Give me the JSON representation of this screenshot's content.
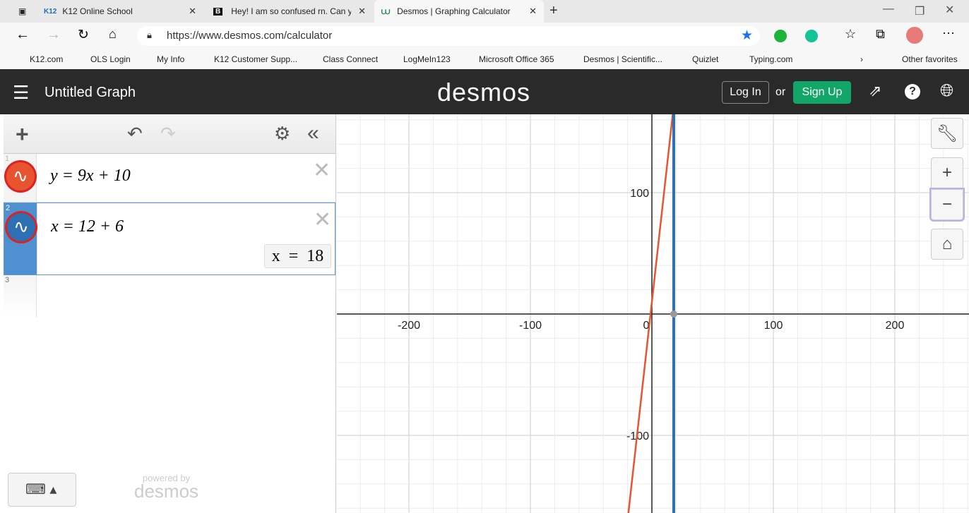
{
  "browser": {
    "tabs": [
      {
        "label": "K12 Online School",
        "icon": "k12-icon"
      },
      {
        "label": "Hey! I am so confused rn. Can yo",
        "icon": "brainly-icon"
      },
      {
        "label": "Desmos | Graphing Calculator",
        "icon": "desmos-icon"
      }
    ],
    "url": "https://www.desmos.com/calculator",
    "bookmarks": [
      "K12.com",
      "OLS Login",
      "My Info",
      "K12 Customer Supp...",
      "Class Connect",
      "LogMeIn123",
      "Microsoft Office 365",
      "Desmos | Scientific...",
      "Quizlet",
      "Typing.com"
    ],
    "other_favorites": "Other favorites"
  },
  "header": {
    "title": "Untitled Graph",
    "logo": "desmos",
    "login": "Log In",
    "or": "or",
    "signup": "Sign Up"
  },
  "expressions": [
    {
      "num": "1",
      "latex": "y = 9x + 10",
      "color": "#e8542f"
    },
    {
      "num": "2",
      "latex": "x = 12 + 6",
      "color": "#2d70b3",
      "result": "x  =  18"
    },
    {
      "num": "3",
      "latex": ""
    }
  ],
  "footer": {
    "powered_by": "powered by",
    "brand": "desmos"
  },
  "graph": {
    "x_ticks": [
      "-200",
      "-100",
      "0",
      "100",
      "200"
    ],
    "y_ticks": [
      "100",
      "-100"
    ],
    "xlim": [
      -260,
      260
    ],
    "ylim": [
      -164,
      165
    ],
    "line_slope": 9,
    "line_intercept": 10,
    "vertical_x": 18,
    "colors": {
      "red": "#e8542f",
      "blue": "#2d70b3"
    }
  }
}
